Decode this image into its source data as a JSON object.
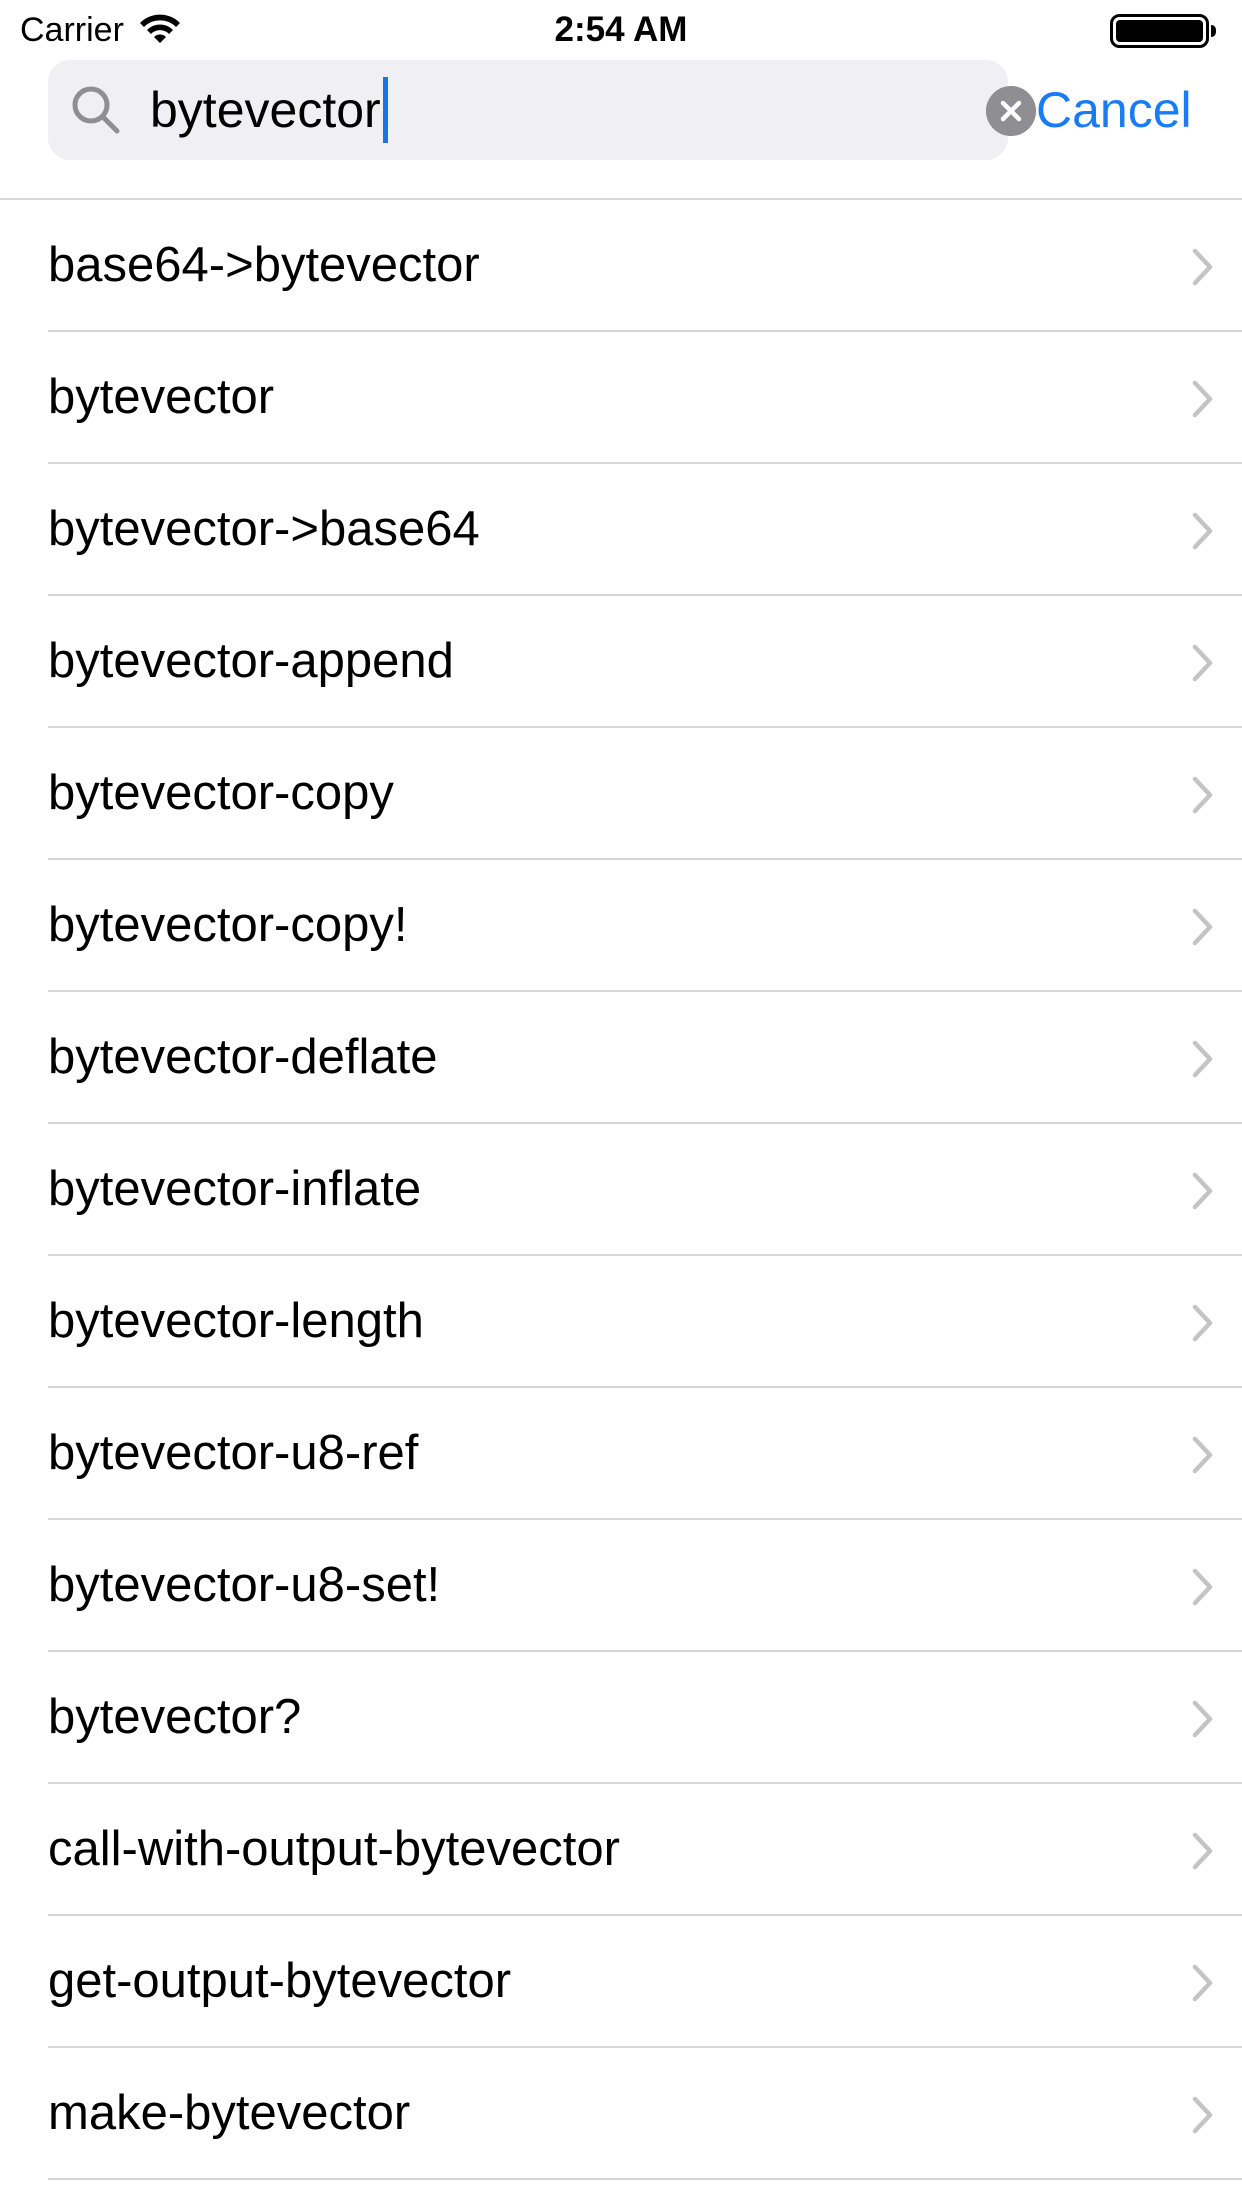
{
  "status_bar": {
    "carrier": "Carrier",
    "time": "2:54 AM",
    "wifi_icon": "wifi-icon",
    "battery_icon": "battery-icon"
  },
  "search": {
    "value": "bytevector",
    "search_icon": "magnifier-icon",
    "clear_icon": "clear-x-icon",
    "cancel_label": "Cancel"
  },
  "colors": {
    "accent": "#1a7cf5",
    "search_field_bg": "#efeff4",
    "separator": "#d6d6da",
    "chevron": "#c4c4c7"
  },
  "results": [
    {
      "label": "base64->bytevector"
    },
    {
      "label": "bytevector"
    },
    {
      "label": "bytevector->base64"
    },
    {
      "label": "bytevector-append"
    },
    {
      "label": "bytevector-copy"
    },
    {
      "label": "bytevector-copy!"
    },
    {
      "label": "bytevector-deflate"
    },
    {
      "label": "bytevector-inflate"
    },
    {
      "label": "bytevector-length"
    },
    {
      "label": "bytevector-u8-ref"
    },
    {
      "label": "bytevector-u8-set!"
    },
    {
      "label": "bytevector?"
    },
    {
      "label": "call-with-output-bytevector"
    },
    {
      "label": "get-output-bytevector"
    },
    {
      "label": "make-bytevector"
    }
  ]
}
